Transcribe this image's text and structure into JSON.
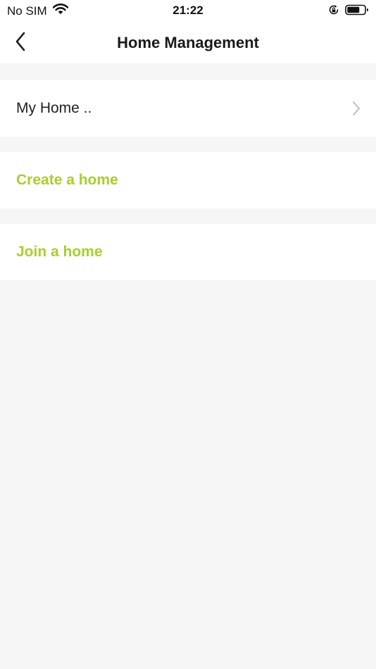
{
  "status_bar": {
    "carrier": "No SIM",
    "time": "21:22",
    "icons": [
      "wifi-icon",
      "rotation-lock-icon",
      "battery-icon"
    ]
  },
  "nav": {
    "title": "Home Management",
    "back_icon": "chevron-left-icon"
  },
  "homes": [
    {
      "name": "My Home ..",
      "chevron_icon": "chevron-right-icon"
    }
  ],
  "actions": {
    "create_label": "Create a home",
    "join_label": "Join a home"
  },
  "colors": {
    "accent": "#a8cf2a",
    "background": "#f6f6f6",
    "surface": "#ffffff",
    "text": "#1c1c1c",
    "chevron": "#bdbdbd"
  }
}
